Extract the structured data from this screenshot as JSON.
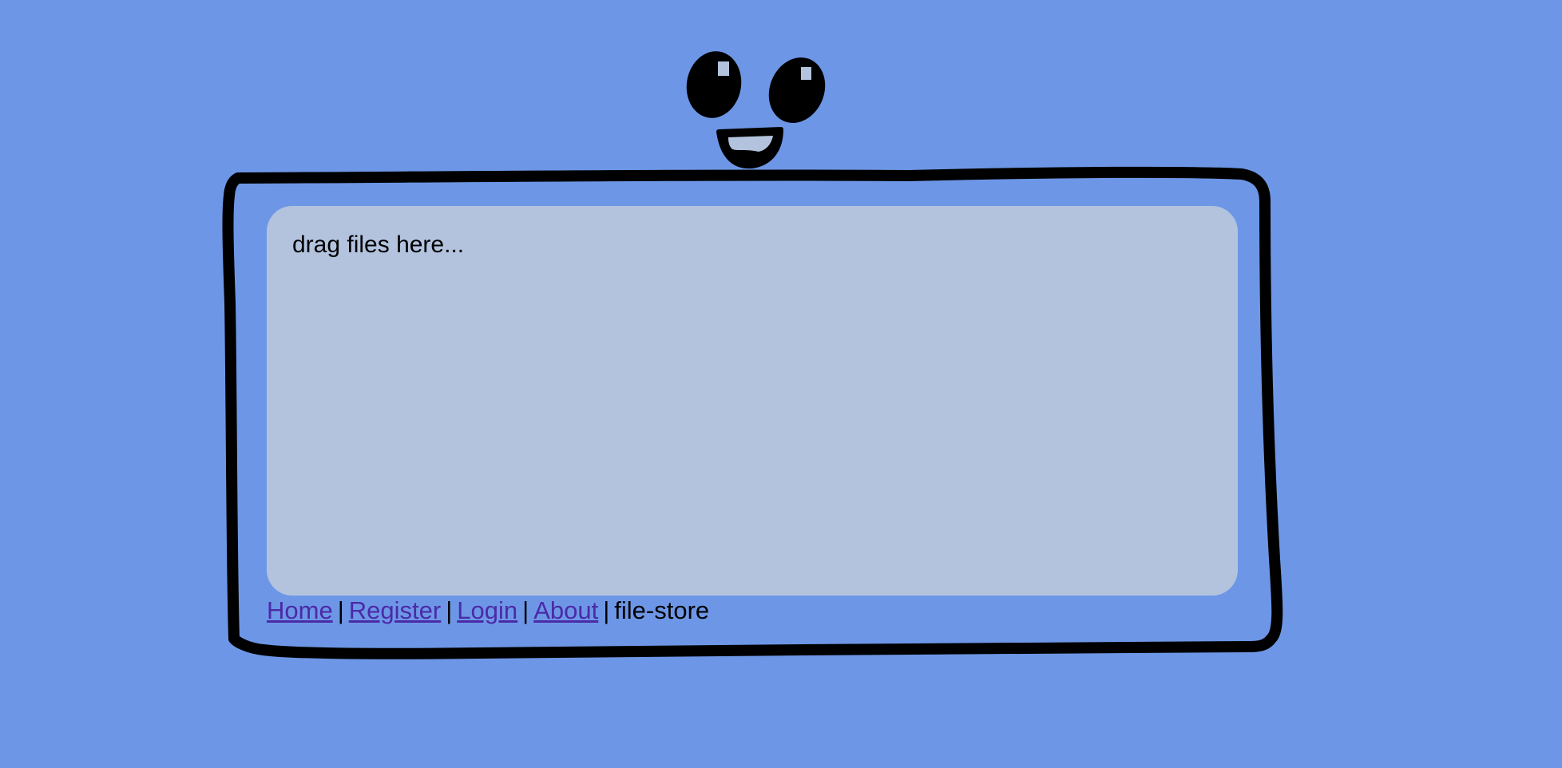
{
  "dropzone": {
    "placeholder": "drag files here..."
  },
  "nav": {
    "links": {
      "home": "Home",
      "register": "Register",
      "login": "Login",
      "about": "About"
    },
    "separator": "|",
    "current": "file-store"
  },
  "colors": {
    "background": "#6d97e6",
    "dropzone": "#b3c3de",
    "link": "#4b2aa8",
    "outline": "#000000"
  },
  "icons": {
    "mascot": "smiling-face-with-box-body"
  }
}
